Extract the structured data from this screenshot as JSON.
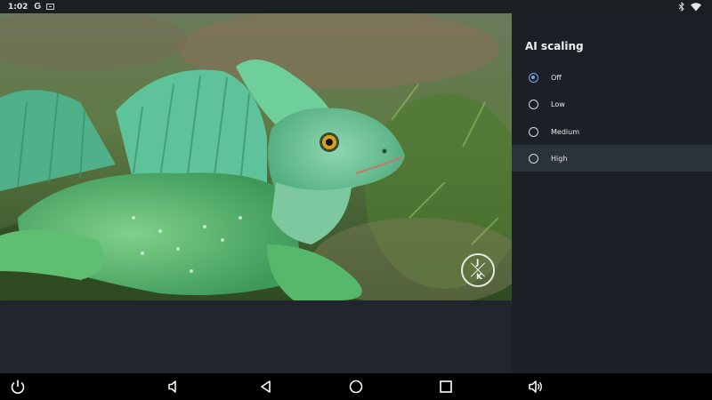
{
  "status_bar": {
    "time": "1:02",
    "google_icon": "G",
    "icons": [
      "google-icon",
      "cast-icon",
      "bluetooth-icon",
      "wifi-icon"
    ]
  },
  "watermark": {
    "letters": [
      "J",
      "K"
    ]
  },
  "panel": {
    "title": "AI scaling",
    "options": [
      {
        "label": "Off",
        "selected": true
      },
      {
        "label": "Low",
        "selected": false
      },
      {
        "label": "Medium",
        "selected": false
      },
      {
        "label": "High",
        "selected": false
      }
    ],
    "highlighted": "High"
  },
  "nav_bar": {
    "buttons": [
      "power-icon",
      "volume-down-icon",
      "back-icon",
      "home-icon",
      "recents-icon",
      "volume-up-icon"
    ]
  },
  "colors": {
    "accent": "#7fa6e8",
    "panel_bg": "#1b2026",
    "highlight_bg": "#2c3239",
    "content_bg": "#20262c"
  }
}
